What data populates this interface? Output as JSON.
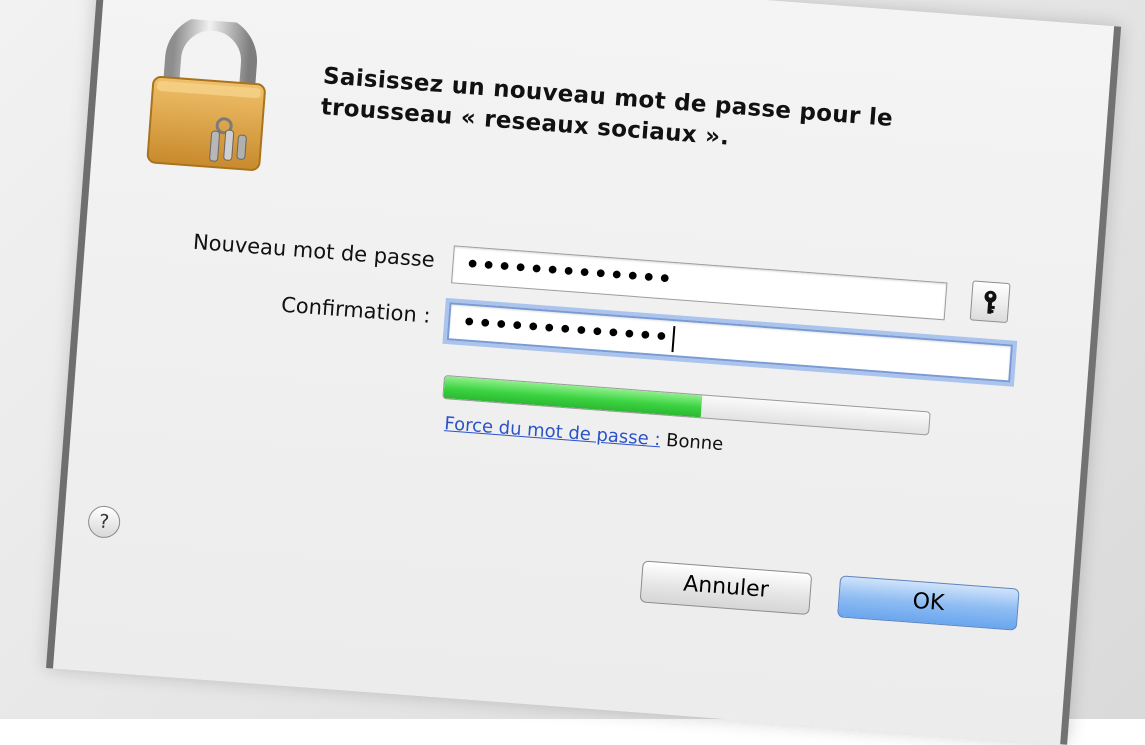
{
  "dialog": {
    "prompt_line1": "Saisissez un nouveau mot de passe pour le",
    "prompt_line2": "trousseau « reseaux sociaux »."
  },
  "form": {
    "new_password_label": "Nouveau mot de passe",
    "new_password_value": "•••••••••••••",
    "confirm_label": "Confirmation :",
    "confirm_value": "•••••••••••••"
  },
  "strength": {
    "link_label": "Force du mot de passe :",
    "value": "Bonne",
    "level": 0.53
  },
  "buttons": {
    "help": "?",
    "cancel": "Annuler",
    "ok": "OK"
  },
  "icons": {
    "lock": "padlock-keychain-icon",
    "key": "key-icon",
    "help": "question-mark-icon"
  },
  "colors": {
    "ok_button": "#6aa6ee",
    "strength_fill": "#3bd341",
    "link": "#2b53c9",
    "focus_ring": "#aac4ee"
  }
}
